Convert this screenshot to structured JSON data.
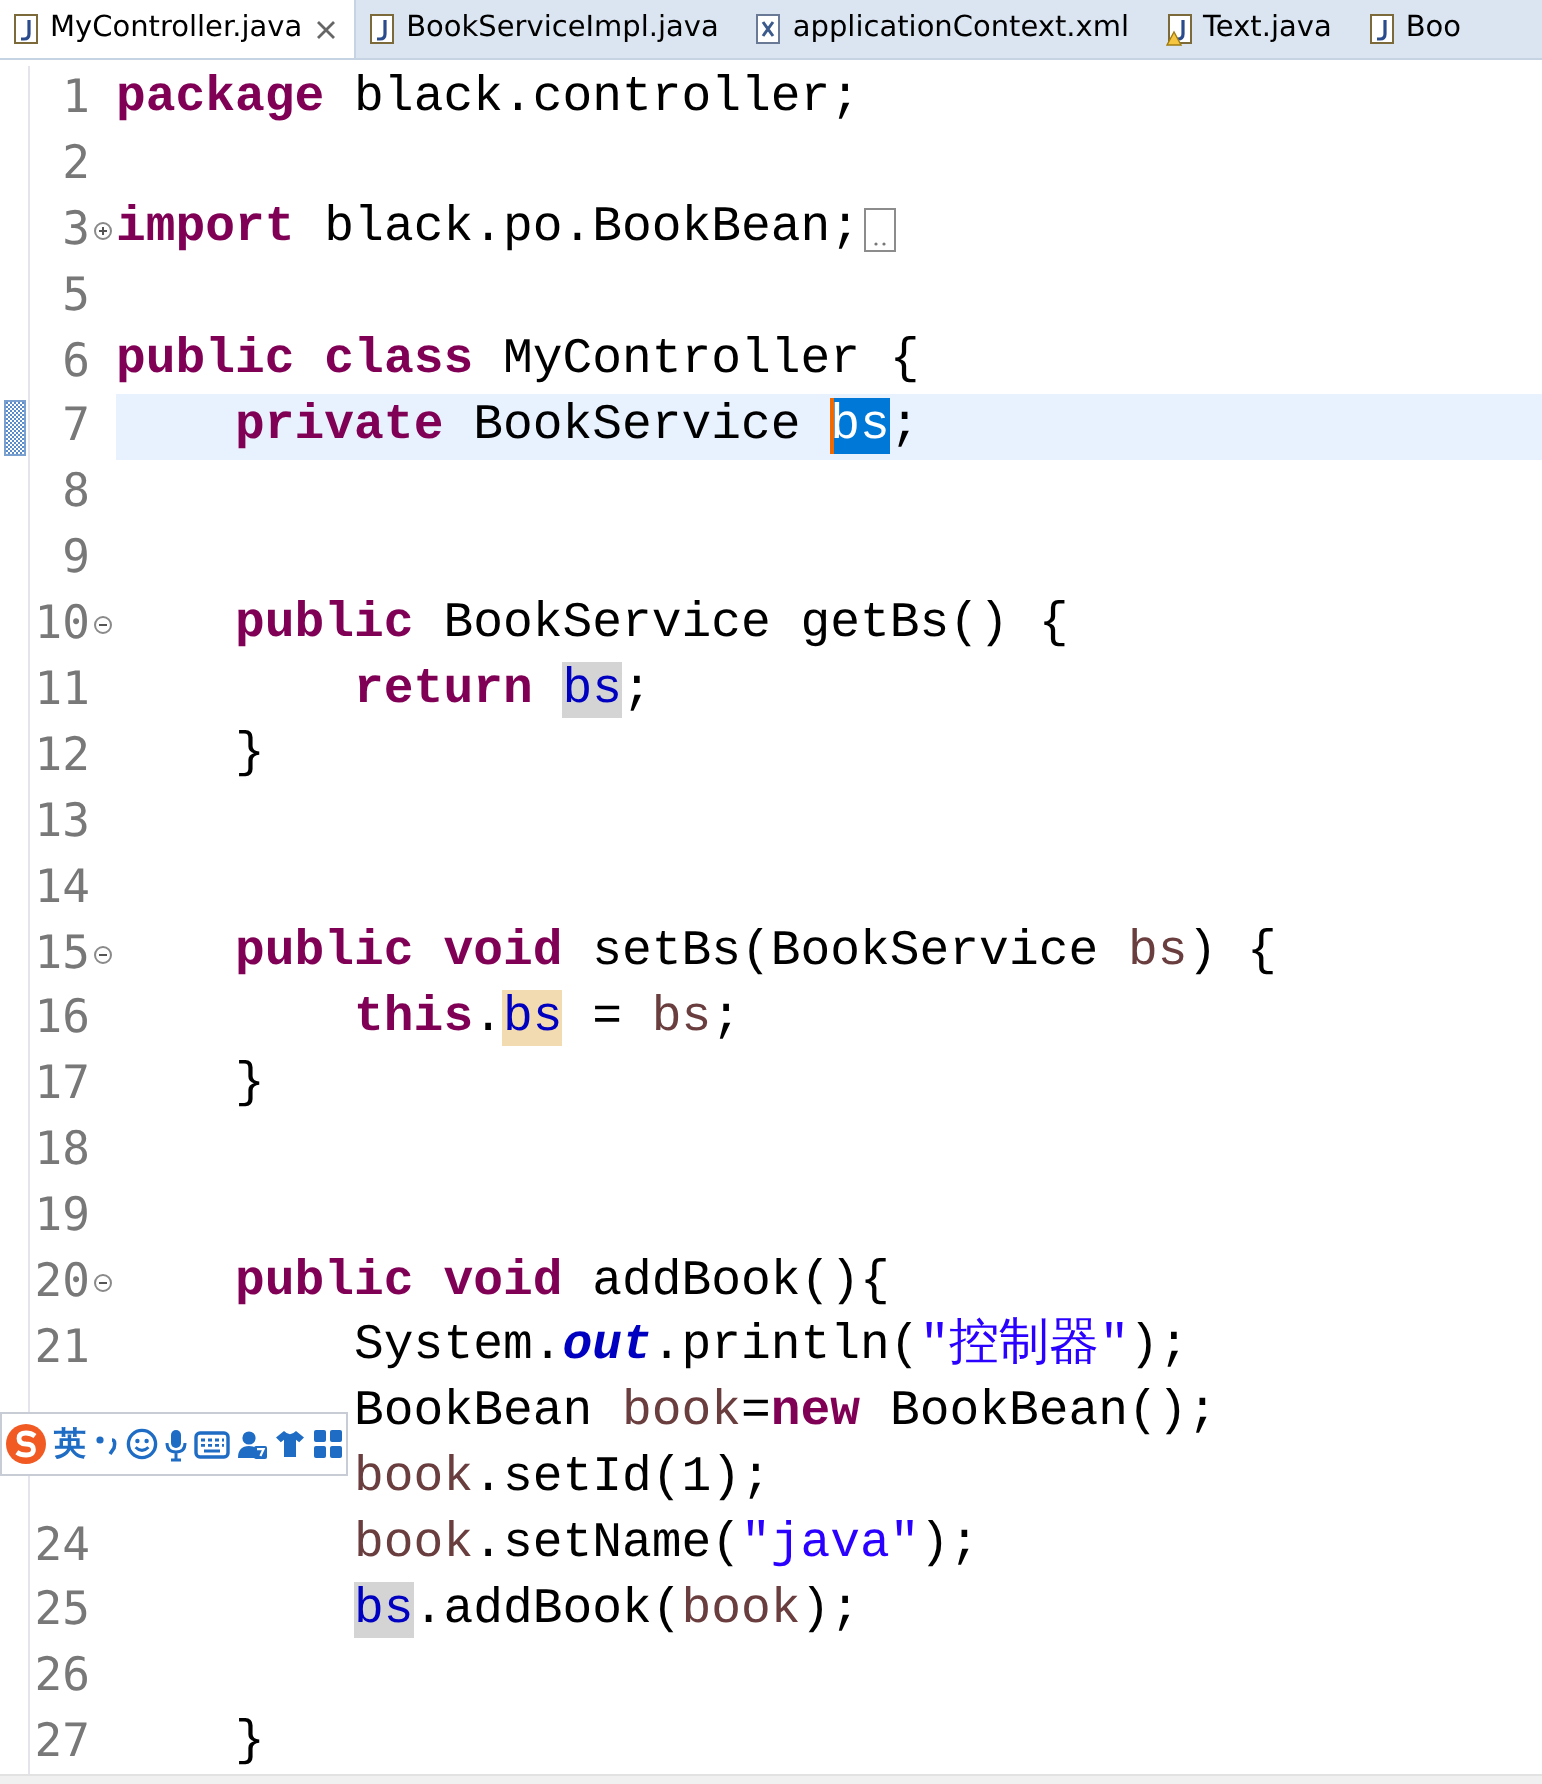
{
  "tabs": [
    {
      "label": "MyController.java",
      "selected": true,
      "kind": "java"
    },
    {
      "label": "BookServiceImpl.java",
      "selected": false,
      "kind": "java"
    },
    {
      "label": "applicationContext.xml",
      "selected": false,
      "kind": "xml"
    },
    {
      "label": "Text.java",
      "selected": false,
      "kind": "java-warning"
    },
    {
      "label": "Boo",
      "selected": false,
      "kind": "java"
    }
  ],
  "editor": {
    "lines": [
      {
        "number": "1",
        "current": false,
        "tokens": [
          {
            "kind": "keyword",
            "text": "package"
          },
          {
            "kind": "plain",
            "text": " black.controller;"
          }
        ]
      },
      {
        "number": "2",
        "current": false
      },
      {
        "number": "3",
        "current": false,
        "collapsed": true,
        "tokens": [
          {
            "kind": "keyword",
            "text": "import"
          },
          {
            "kind": "plain",
            "text": " black.po.BookBean;"
          }
        ]
      },
      {
        "number": "5",
        "current": false
      },
      {
        "number": "6",
        "current": false,
        "tokens": [
          {
            "kind": "keyword",
            "text": "public"
          },
          {
            "kind": "keyword",
            "text": " class"
          },
          {
            "kind": "plain",
            "text": " MyController {"
          }
        ]
      },
      {
        "number": "7",
        "current": true,
        "tokens": [
          {
            "kind": "keyword",
            "text": "    private"
          },
          {
            "kind": "plain",
            "text": " BookService "
          },
          {
            "kind": "field",
            "text": "bs",
            "selected": true
          },
          {
            "kind": "plain",
            "text": ";"
          }
        ]
      },
      {
        "number": "8",
        "current": false
      },
      {
        "number": "9",
        "current": false
      },
      {
        "number": "10",
        "current": false,
        "collapsed": false,
        "tokens": [
          {
            "kind": "keyword",
            "text": "    public"
          },
          {
            "kind": "plain",
            "text": " BookService getBs() {"
          }
        ]
      },
      {
        "number": "11",
        "current": false,
        "tokens": [
          {
            "kind": "keyword",
            "text": "        return"
          },
          {
            "kind": "field",
            "text": " bs",
            "selected": false,
            "occurrence": true,
            "write": false
          },
          {
            "kind": "plain",
            "text": ";"
          }
        ]
      },
      {
        "number": "12",
        "current": false,
        "tokens": [
          {
            "kind": "plain",
            "text": "    }"
          }
        ]
      },
      {
        "number": "13",
        "current": false
      },
      {
        "number": "14",
        "current": false
      },
      {
        "number": "15",
        "current": false,
        "collapsed": false,
        "tokens": [
          {
            "kind": "keyword",
            "text": "    public"
          },
          {
            "kind": "keyword",
            "text": " void"
          },
          {
            "kind": "plain",
            "text": " setBs(BookService "
          },
          {
            "kind": "local",
            "text": "bs"
          },
          {
            "kind": "plain",
            "text": ") {"
          }
        ]
      },
      {
        "number": "16",
        "current": false,
        "tokens": [
          {
            "kind": "keyword",
            "text": "        this"
          },
          {
            "kind": "plain",
            "text": "."
          },
          {
            "kind": "field",
            "text": "bs",
            "selected": false,
            "occurrence": true,
            "write": true
          },
          {
            "kind": "plain",
            "text": " = "
          },
          {
            "kind": "local",
            "text": "bs"
          },
          {
            "kind": "plain",
            "text": ";"
          }
        ]
      },
      {
        "number": "17",
        "current": false,
        "tokens": [
          {
            "kind": "plain",
            "text": "    }"
          }
        ]
      },
      {
        "number": "18",
        "current": false
      },
      {
        "number": "19",
        "current": false
      },
      {
        "number": "20",
        "current": false,
        "collapsed": false,
        "tokens": [
          {
            "kind": "keyword",
            "text": "    public"
          },
          {
            "kind": "keyword",
            "text": " void"
          },
          {
            "kind": "plain",
            "text": " addBook(){"
          }
        ]
      },
      {
        "number": "21",
        "current": false,
        "tokens": [
          {
            "kind": "plain",
            "text": "        System."
          },
          {
            "kind": "static",
            "text": "out"
          },
          {
            "kind": "plain",
            "text": ".println("
          },
          {
            "kind": "string",
            "text": "\"控制器\""
          },
          {
            "kind": "plain",
            "text": ");"
          }
        ]
      },
      {
        "current": false,
        "tokens": [
          {
            "kind": "plain",
            "text": "        BookBean "
          },
          {
            "kind": "local",
            "text": "book"
          },
          {
            "kind": "plain",
            "text": "="
          },
          {
            "kind": "keyword",
            "text": "new"
          },
          {
            "kind": "plain",
            "text": " BookBean();"
          }
        ]
      },
      {
        "current": false,
        "tokens": [
          {
            "kind": "local",
            "text": "        book"
          },
          {
            "kind": "plain",
            "text": ".setId(1);"
          }
        ]
      },
      {
        "number": "24",
        "current": false,
        "tokens": [
          {
            "kind": "local",
            "text": "        book"
          },
          {
            "kind": "plain",
            "text": ".setName("
          },
          {
            "kind": "string",
            "text": "\"java\""
          },
          {
            "kind": "plain",
            "text": ");"
          }
        ]
      },
      {
        "number": "25",
        "current": false,
        "tokens": [
          {
            "kind": "field",
            "text": "        bs",
            "selected": false,
            "occurrence": true,
            "write": false
          },
          {
            "kind": "plain",
            "text": ".addBook("
          },
          {
            "kind": "local",
            "text": "book"
          },
          {
            "kind": "plain",
            "text": ");"
          }
        ]
      },
      {
        "number": "26",
        "current": false
      },
      {
        "number": "27",
        "current": false,
        "tokens": [
          {
            "kind": "plain",
            "text": "    }"
          }
        ]
      }
    ]
  },
  "ime_toolbar": {
    "mode": "英"
  }
}
